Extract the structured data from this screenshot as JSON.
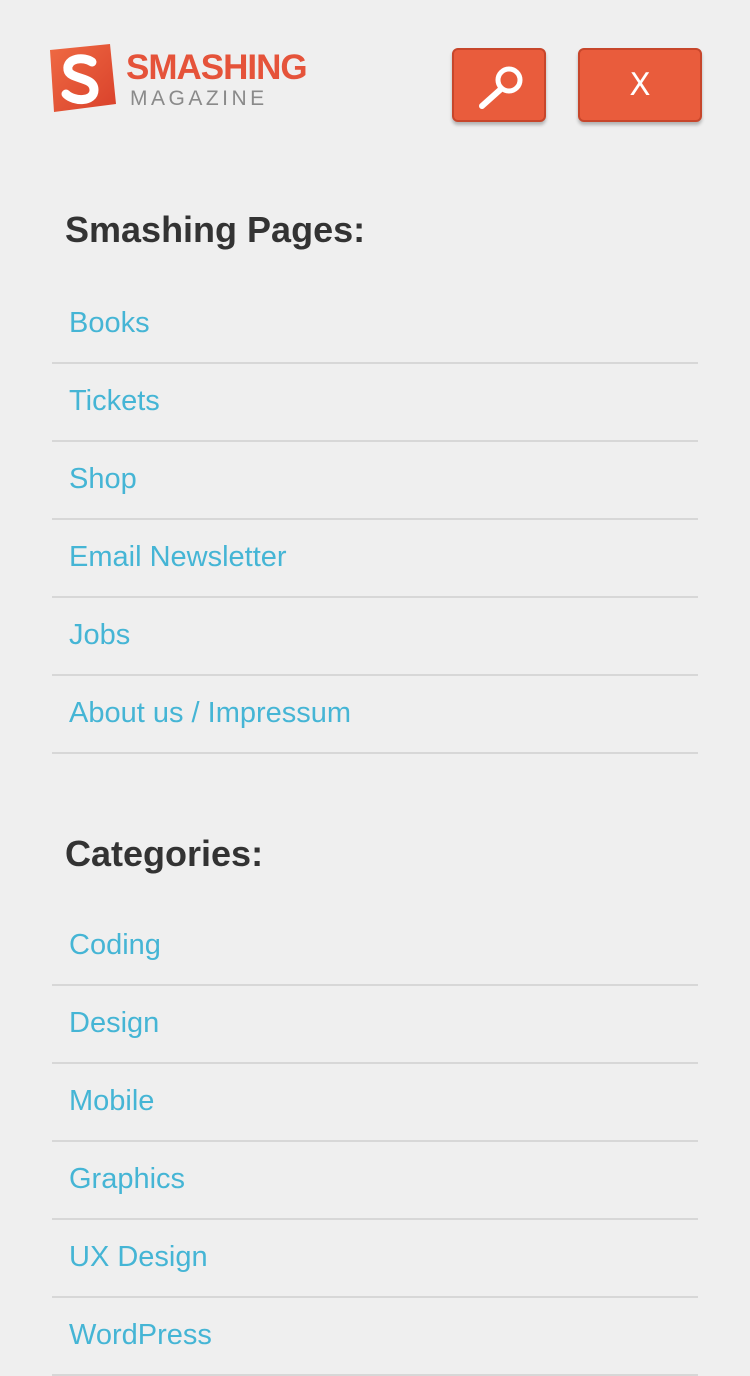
{
  "header": {
    "logo": {
      "name": "SMASHING",
      "tagline": "MAGAZINE"
    },
    "search_button": {
      "icon": "search-icon"
    },
    "close_button": {
      "label": "X"
    }
  },
  "sections": [
    {
      "title": "Smashing Pages:",
      "items": [
        {
          "label": "Books"
        },
        {
          "label": "Tickets"
        },
        {
          "label": "Shop"
        },
        {
          "label": "Email Newsletter"
        },
        {
          "label": "Jobs"
        },
        {
          "label": "About us / Impressum"
        }
      ]
    },
    {
      "title": "Categories:",
      "items": [
        {
          "label": "Coding"
        },
        {
          "label": "Design"
        },
        {
          "label": "Mobile"
        },
        {
          "label": "Graphics"
        },
        {
          "label": "UX Design"
        },
        {
          "label": "WordPress"
        }
      ]
    }
  ],
  "colors": {
    "accent": "#e95c3c",
    "link": "#45b5d5",
    "heading": "#333333",
    "background": "#efefef"
  }
}
